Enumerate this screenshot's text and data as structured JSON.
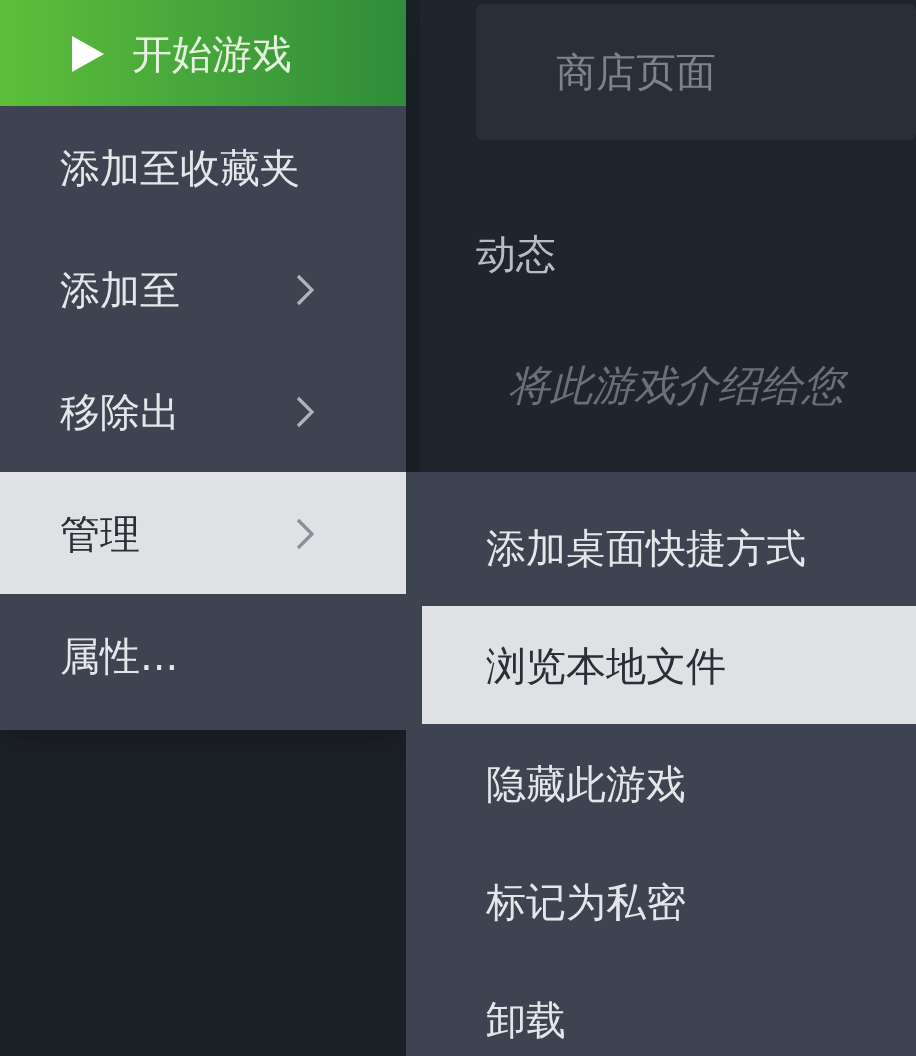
{
  "background": {
    "store_button": "商店页面",
    "section_title": "动态",
    "prompt": "将此游戏介绍给您"
  },
  "context_menu": {
    "play_button": "开始游戏",
    "items": [
      {
        "label": "添加至收藏夹",
        "has_submenu": false,
        "selected": false
      },
      {
        "label": "添加至",
        "has_submenu": true,
        "selected": false
      },
      {
        "label": "移除出",
        "has_submenu": true,
        "selected": false
      },
      {
        "label": "管理",
        "has_submenu": true,
        "selected": true
      },
      {
        "label": "属性...",
        "has_submenu": false,
        "selected": false
      }
    ]
  },
  "submenu": {
    "items": [
      {
        "label": "添加桌面快捷方式",
        "selected": false
      },
      {
        "label": "浏览本地文件",
        "selected": true
      },
      {
        "label": "隐藏此游戏",
        "selected": false
      },
      {
        "label": "标记为私密",
        "selected": false
      },
      {
        "label": "卸载",
        "selected": false
      }
    ]
  }
}
